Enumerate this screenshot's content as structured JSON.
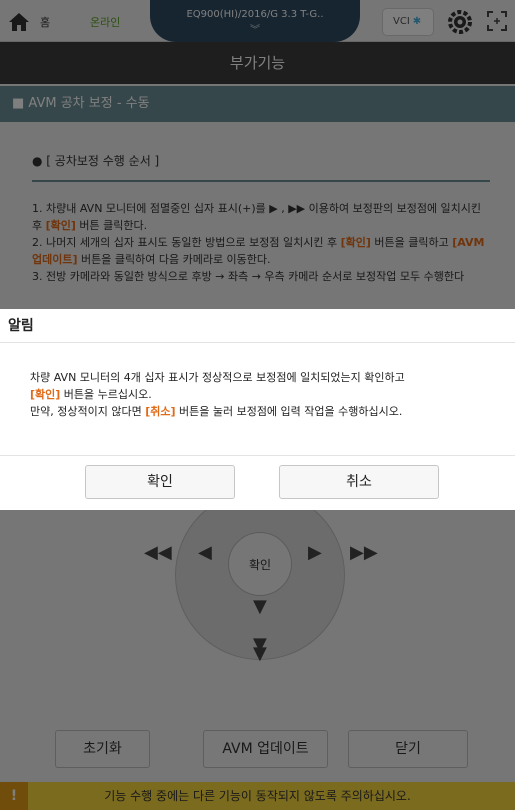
{
  "topbar": {
    "home_label": "홈",
    "online_label": "온라인",
    "vehicle": "EQ900(HI)/2016/G 3.3 T-G..",
    "vci_label": "VCI"
  },
  "page": {
    "title": "부가기능",
    "section": "■ AVM 공차 보정 - 수동"
  },
  "instructions": {
    "title": "● [ 공차보정 수행 순서 ]",
    "step1_a": "1. 차량내 AVN 모니터에 점멸중인 십자 표시(+)를 ▶ , ▶▶ 이용하여 보정판의 보정점에 일치시킨 후 ",
    "step1_hl": "[확인]",
    "step1_b": " 버튼 클릭한다.",
    "step2_a": "2. 나머지 세개의 십자 표시도 동일한 방법으로 보정점 일치시킨 후 ",
    "step2_hl1": "[확인]",
    "step2_b": " 버튼을 클릭하고 ",
    "step2_hl2": "[AVM 업데이트]",
    "step2_c": " 버튼을 클릭하여 다음 카메라로 이동한다.",
    "step3": "3. 전방 카메라와 동일한 방식으로 후방 → 좌측 → 우측 카메라 순서로 보정작업 모두 수행한다"
  },
  "controls": {
    "center_label": "확인",
    "reset_label": "초기화",
    "avm_update_label": "AVM 업데이트",
    "close_label": "닫기"
  },
  "warning": {
    "text": "기능 수행 중에는 다른 기능이 동작되지 않도록 주의하십시오.",
    "icon_glyph": "!"
  },
  "dialog": {
    "title": "알림",
    "line1": "차량 AVN 모니터의 4개 십자 표시가 정상적으로 보정점에 일치되었는지 확인하고",
    "line2_hl": "[확인]",
    "line2_b": " 버튼을 누르십시오.",
    "line3_a": "만약, 정상적이지 않다면 ",
    "line3_hl": "[취소]",
    "line3_b": " 버튼을 눌러 보정점에 입력 작업을 수행하십시오.",
    "confirm_label": "확인",
    "cancel_label": "취소"
  },
  "colors": {
    "accent_orange": "#e06a18",
    "section_teal": "#6d8f97",
    "vehicle_tab": "#2f4a63",
    "warning_yellow": "#f5d63d"
  }
}
